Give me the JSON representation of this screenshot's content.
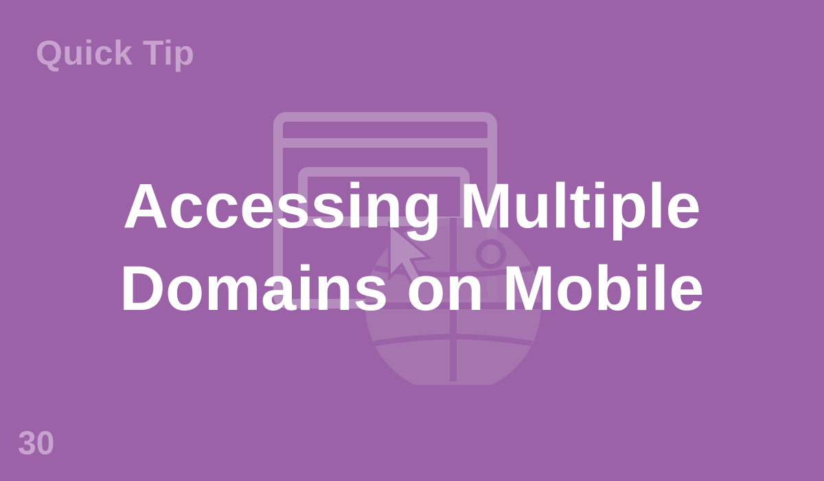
{
  "header": {
    "label": "Quick Tip"
  },
  "main": {
    "title_line1": "Accessing Multiple",
    "title_line2": "Domains on Mobile"
  },
  "footer": {
    "number": "30"
  },
  "icons": {
    "background": "browser-globe-cursor-icon"
  },
  "colors": {
    "background": "#9c62a8",
    "label": "#c8a3cf",
    "title": "#ffffff"
  }
}
